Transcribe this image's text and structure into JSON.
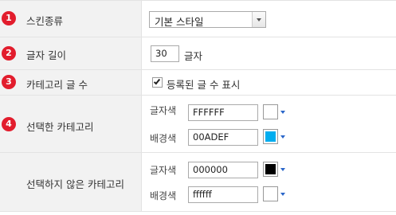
{
  "rows": [
    {
      "number": "1",
      "label": "스킨종류"
    },
    {
      "number": "2",
      "label": "글자 길이"
    },
    {
      "number": "3",
      "label": "카테고리 글 수"
    },
    {
      "number": "4",
      "label": "선택한 카테고리"
    },
    {
      "number": "",
      "label": "선택하지 않은 카테고리"
    }
  ],
  "skin": {
    "selected": "기본 스타일"
  },
  "text_length": {
    "value": "30",
    "suffix": "글자"
  },
  "post_count": {
    "checked": true,
    "label": "등록된 글 수 표시"
  },
  "selected_category": {
    "text_color_label": "글자색",
    "text_color_value": "FFFFFF",
    "text_color_swatch": "#ffffff",
    "bg_color_label": "배경색",
    "bg_color_value": "00ADEF",
    "bg_color_swatch": "#00adef"
  },
  "unselected_category": {
    "text_color_label": "글자색",
    "text_color_value": "000000",
    "text_color_swatch": "#000000",
    "bg_color_label": "배경색",
    "bg_color_value": "ffffff",
    "bg_color_swatch": "#ffffff"
  }
}
